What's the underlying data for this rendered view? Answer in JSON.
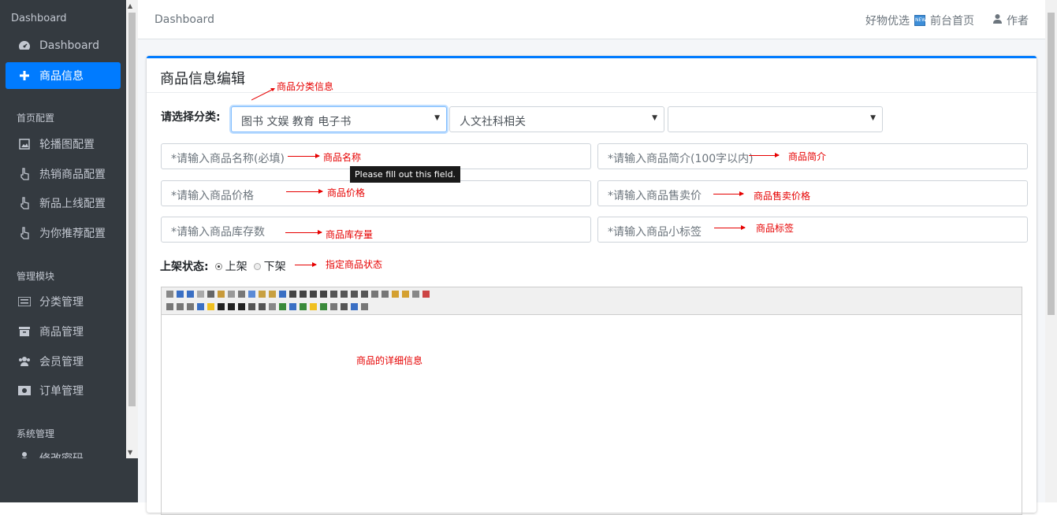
{
  "sidebar": {
    "brand": "Dashboard",
    "items": [
      {
        "label": "Dashboard",
        "icon": "tachometer-icon"
      },
      {
        "label": "商品信息",
        "icon": "plus-icon",
        "active": true
      }
    ],
    "sections": [
      {
        "header": "首页配置",
        "items": [
          {
            "label": "轮播图配置",
            "icon": "image-icon"
          },
          {
            "label": "热销商品配置",
            "icon": "hand-pointer-icon"
          },
          {
            "label": "新品上线配置",
            "icon": "hand-pointer-icon"
          },
          {
            "label": "为你推荐配置",
            "icon": "hand-pointer-icon"
          }
        ]
      },
      {
        "header": "管理模块",
        "items": [
          {
            "label": "分类管理",
            "icon": "list-icon"
          },
          {
            "label": "商品管理",
            "icon": "archive-icon"
          },
          {
            "label": "会员管理",
            "icon": "users-icon"
          },
          {
            "label": "订单管理",
            "icon": "money-bill-icon"
          }
        ]
      },
      {
        "header": "系统管理",
        "items": [
          {
            "label": "修改密码",
            "icon": "user-secret-icon"
          }
        ]
      }
    ]
  },
  "topnav": {
    "breadcrumb": "Dashboard",
    "link1": "好物优选",
    "link2": "前台首页",
    "user": "作者"
  },
  "card": {
    "title": "商品信息编辑",
    "category_label": "请选择分类:",
    "category1": "图书 文娱 教育 电子书",
    "category2": "人文社科相关",
    "category3": "",
    "name_placeholder": "*请输入商品名称(必填)",
    "intro_placeholder": "*请输入商品简介(100字以内)",
    "price_placeholder": "*请输入商品价格",
    "selling_price_placeholder": "*请输入商品售卖价",
    "stock_placeholder": "*请输入商品库存数",
    "tag_placeholder": "*请输入商品小标签",
    "status_label": "上架状态:",
    "status_on": "上架",
    "status_off": "下架",
    "tooltip": "Please fill out this field."
  },
  "annotations": {
    "category": "商品分类信息",
    "name": "商品名称",
    "intro": "商品简介",
    "price": "商品价格",
    "selling_price": "商品售卖价格",
    "stock": "商品库存量",
    "tag": "商品标签",
    "status": "指定商品状态",
    "detail": "商品的详细信息"
  },
  "colors": {
    "sidebar_bg": "#343a40",
    "accent": "#007bff",
    "annotation": "#e60000"
  }
}
